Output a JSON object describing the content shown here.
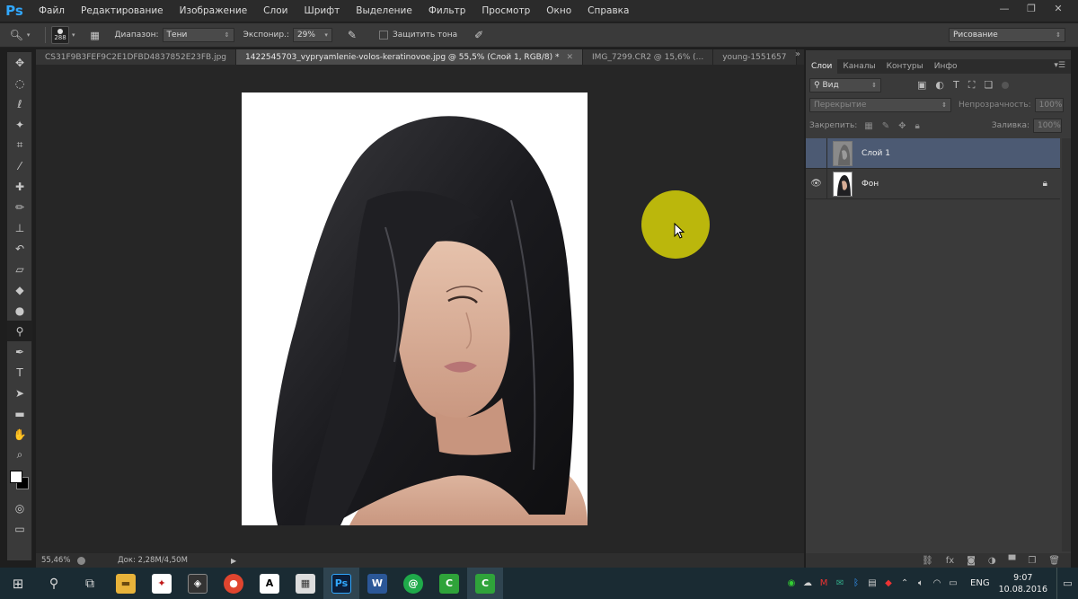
{
  "app": {
    "logo": "Ps"
  },
  "menu": [
    "Файл",
    "Редактирование",
    "Изображение",
    "Слои",
    "Шрифт",
    "Выделение",
    "Фильтр",
    "Просмотр",
    "Окно",
    "Справка"
  ],
  "options": {
    "brush_size": "288",
    "range_label": "Диапазон:",
    "range_value": "Тени",
    "exposure_label": "Экспонир.:",
    "exposure_value": "29%",
    "protect_tones_label": "Защитить тона",
    "workspace": "Рисование"
  },
  "tabs": [
    {
      "label": "CS31F9B3FEF9C2E1DFBD4837852E23FB.jpg"
    },
    {
      "label": "1422545703_vypryamlenie-volos-keratinovoe.jpg @ 55,5% (Слой 1, RGB/8) *"
    },
    {
      "label": "IMG_7299.CR2 @ 15,6% (..."
    },
    {
      "label": "young-1551657"
    }
  ],
  "tabs_more": "»",
  "status": {
    "zoom": "55,46%",
    "doc": "Док: 2,28M/4,50M"
  },
  "panel": {
    "tabs": [
      "Слои",
      "Каналы",
      "Контуры",
      "Инфо"
    ],
    "filter_kind": "Вид",
    "blend_mode": "Перекрытие",
    "opacity_label": "Непрозрачность:",
    "opacity_value": "100%",
    "lock_label": "Закрепить:",
    "fill_label": "Заливка:",
    "fill_value": "100%",
    "layers": [
      {
        "name": "Слой 1",
        "active": true,
        "visible": false,
        "locked": false
      },
      {
        "name": "Фон",
        "active": false,
        "visible": true,
        "locked": true
      }
    ]
  },
  "taskbar": {
    "lang": "ENG",
    "time": "9:07",
    "date": "10.08.2016"
  },
  "colors": {
    "accent": "#31a8ff",
    "selection": "#4c5a73",
    "highlight": "#c8c30a"
  }
}
